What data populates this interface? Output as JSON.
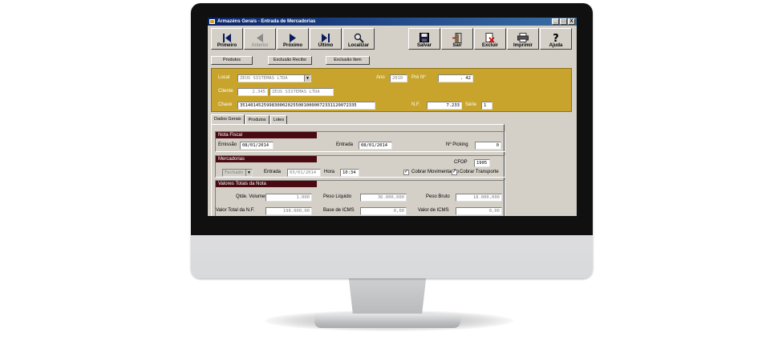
{
  "window": {
    "title": "Armazéns Gerais - Entrada de Mercadorias",
    "controls": [
      "_",
      "□",
      "X"
    ]
  },
  "toolbar": {
    "first": "Primeiro",
    "previous": "Anterior",
    "next": "Próximo",
    "last": "Último",
    "search": "Localizar",
    "save": "Salvar",
    "exit": "Sair",
    "delete": "Excluir",
    "print": "Imprimir",
    "help": "Ajuda"
  },
  "subbuttons": {
    "products": "Produtos",
    "delete_receipt": "Exclusão Recibo",
    "delete_item": "Exclusão Item"
  },
  "header": {
    "local_label": "Local",
    "local_value": "ZEUS SISTEMAS LTDA",
    "year_label": "Ano",
    "year_value": "2010",
    "pre_label": "Pré Nº",
    "pre_value": ". 42",
    "client_label": "Cliente",
    "client_code": "2.345",
    "client_name": "ZEUS SISTEMAS LTDA",
    "key_label": "Chave",
    "key_value": "35140145259983000202550010000072331120072335",
    "nf_label": "N.F.",
    "nf_value": "7.233",
    "series_label": "Série",
    "series_value": "1"
  },
  "tabs": [
    "Dados Gerais",
    "Produtos",
    "Lotes"
  ],
  "nota_fiscal": {
    "title": "Nota Fiscal",
    "emission_label": "Emissão",
    "emission_value": "08/01/2014",
    "entry_label": "Entrada",
    "entry_value": "08/01/2014",
    "picking_label": "Nº Picking",
    "picking_value": "0"
  },
  "mercadorias": {
    "title": "Mercadorias",
    "status_value": "Fechado",
    "entry_label": "Entrada",
    "entry_value": "03/01/2014",
    "time_label": "Hora",
    "time_value": "10:34",
    "cfop_label": "CFOP",
    "cfop_value": "1905",
    "charge_movement": "Cobrar Movimentação",
    "charge_transport": "Cobrar Transporte",
    "check_mark": "✓"
  },
  "totais": {
    "title": "Valores Totais da Nota",
    "volumes_label": "Qtde. Volumes",
    "volumes_value": "1.000",
    "net_weight_label": "Peso Líquido",
    "net_weight_value": "36.000,000",
    "gross_weight_label": "Peso Bruto",
    "gross_weight_value": "18.000,000",
    "nf_total_label": "Valor Total da N.F.",
    "nf_total_value": "198.000,00",
    "icms_base_label": "Base de ICMS",
    "icms_base_value": "0,00",
    "icms_value_label": "Valor de ICMS",
    "icms_value": "0,00"
  },
  "colors": {
    "header_gold": "#c8a42c",
    "section_header": "#4a0a12",
    "titlebar": "#0a246a"
  }
}
